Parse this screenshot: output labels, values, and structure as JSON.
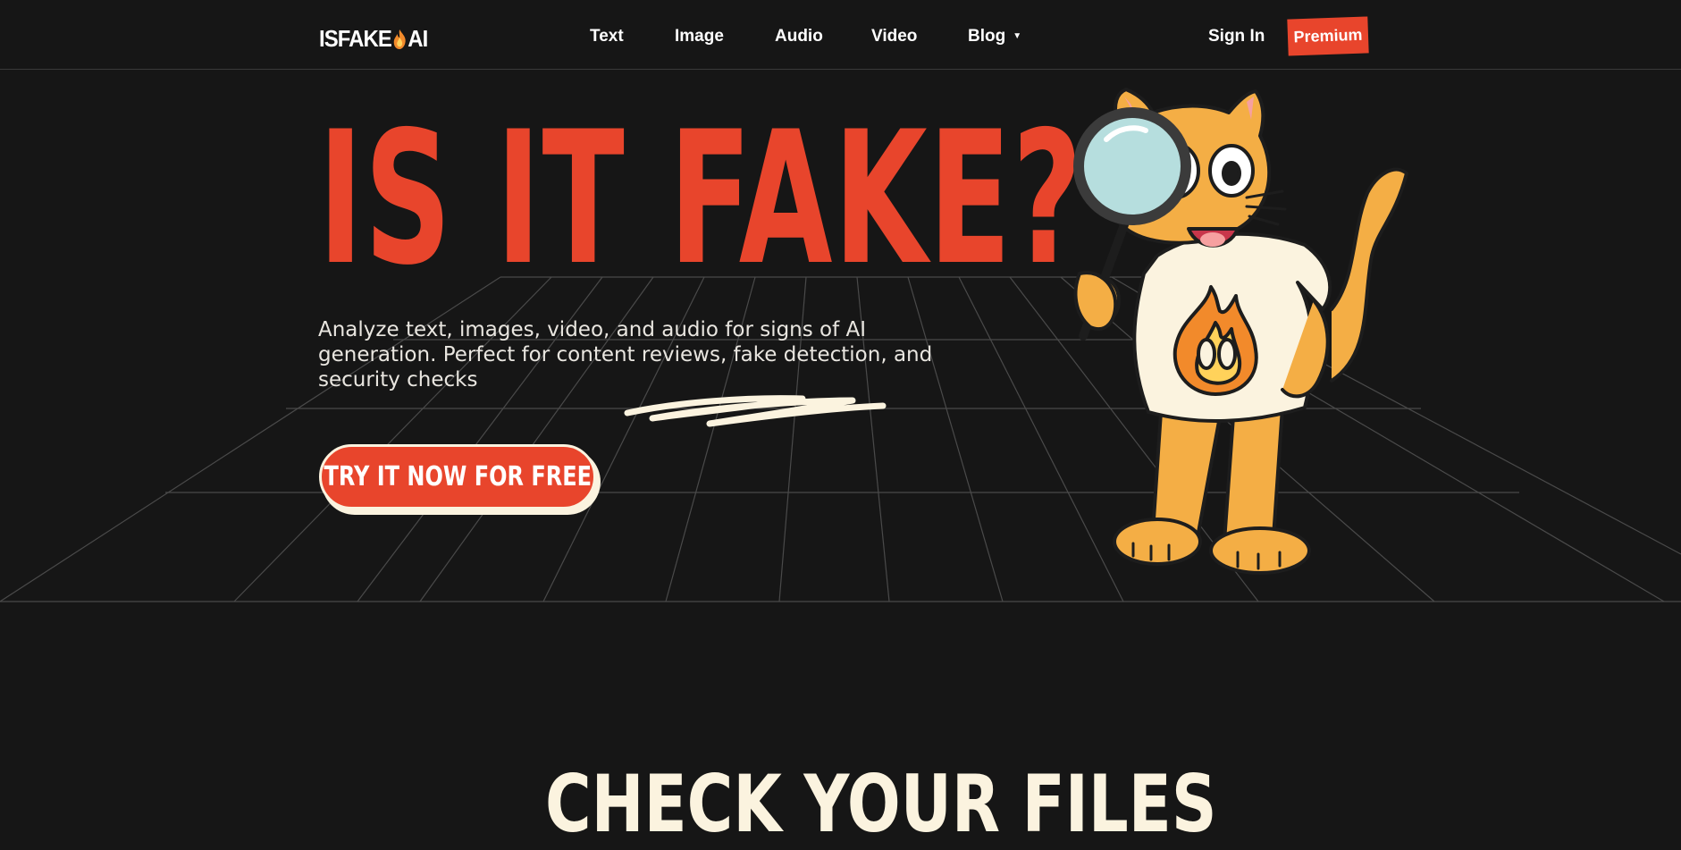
{
  "brand": {
    "logo_text_left": "ISFAKE",
    "logo_text_right": "AI"
  },
  "nav": {
    "links": [
      {
        "label": "Text"
      },
      {
        "label": "Image"
      },
      {
        "label": "Audio"
      },
      {
        "label": "Video"
      },
      {
        "label": "Blog",
        "has_dropdown": true
      }
    ],
    "sign_in": "Sign In",
    "premium": "Premium"
  },
  "hero": {
    "title": "IS IT FAKE?",
    "subtitle": "Analyze text, images, video, and audio for signs of AI generation. Perfect for content reviews, fake detection, and security checks",
    "cta": "TRY IT NOW FOR FREE"
  },
  "section": {
    "title": "CHECK YOUR FILES"
  },
  "colors": {
    "background": "#161616",
    "accent": "#e8452c",
    "cream": "#fbf3df",
    "cat": "#f4ae45"
  }
}
